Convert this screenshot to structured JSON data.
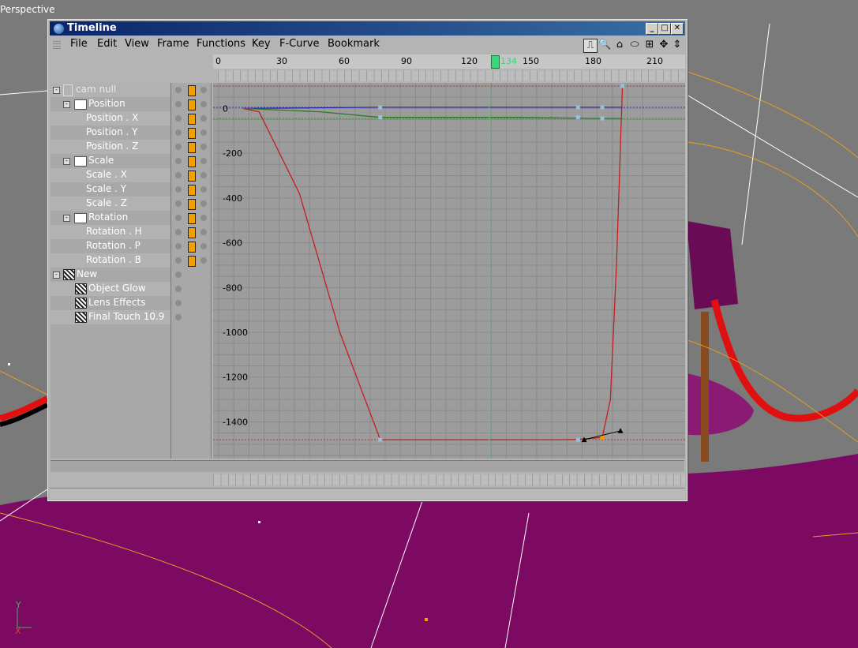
{
  "viewport": {
    "label": "Perspective",
    "axis_y": "Y",
    "axis_x": "X",
    "background_color": "#7a7a7a",
    "floor_color": "#7c0a63"
  },
  "window": {
    "title": "Timeline",
    "controls": {
      "minimize": "_",
      "maximize": "□",
      "close": "✕"
    }
  },
  "menu": [
    "File",
    "Edit",
    "View",
    "Frame",
    "Functions",
    "Key",
    "F-Curve",
    "Bookmark"
  ],
  "toolbar_icons": [
    "curve-mode-icon",
    "zoom-icon",
    "home-icon",
    "ellipse-icon",
    "fit-icon",
    "move-icon",
    "scroll-icon"
  ],
  "toolbar_glyphs": [
    "⎍",
    "🔍",
    "⌂",
    "⬭",
    "⊞",
    "✥",
    "⇕"
  ],
  "ruler": {
    "ticks": [
      "0",
      "30",
      "60",
      "90",
      "120",
      "150",
      "180",
      "210"
    ],
    "current_frame": "134"
  },
  "tree": {
    "rows": [
      {
        "label": "cam null",
        "indent": 0,
        "kind": "object"
      },
      {
        "label": "Position",
        "indent": 1,
        "kind": "folder"
      },
      {
        "label": "Position . X",
        "indent": 2,
        "kind": "track"
      },
      {
        "label": "Position . Y",
        "indent": 2,
        "kind": "track"
      },
      {
        "label": "Position . Z",
        "indent": 2,
        "kind": "track"
      },
      {
        "label": "Scale",
        "indent": 1,
        "kind": "folder"
      },
      {
        "label": "Scale . X",
        "indent": 2,
        "kind": "track"
      },
      {
        "label": "Scale . Y",
        "indent": 2,
        "kind": "track"
      },
      {
        "label": "Scale . Z",
        "indent": 2,
        "kind": "track"
      },
      {
        "label": "Rotation",
        "indent": 1,
        "kind": "folder"
      },
      {
        "label": "Rotation . H",
        "indent": 2,
        "kind": "track"
      },
      {
        "label": "Rotation . P",
        "indent": 2,
        "kind": "track"
      },
      {
        "label": "Rotation . B",
        "indent": 2,
        "kind": "track"
      },
      {
        "label": "New",
        "indent": 0,
        "kind": "effect-group"
      },
      {
        "label": "Object Glow",
        "indent": 1,
        "kind": "effect"
      },
      {
        "label": "Lens Effects",
        "indent": 1,
        "kind": "effect"
      },
      {
        "label": "Final Touch 10.9",
        "indent": 1,
        "kind": "effect"
      }
    ]
  },
  "chart_data": {
    "type": "line",
    "title": "",
    "xlabel": "",
    "ylabel": "",
    "xlim": [
      0,
      215
    ],
    "ylim": [
      -1550,
      100
    ],
    "y_ticks": [
      "0",
      "-200",
      "-400",
      "-600",
      "-800",
      "-1000",
      "-1200",
      "-1400"
    ],
    "current_frame": 134,
    "series": [
      {
        "color": "#c41f1f",
        "x": [
          12,
          20,
          40,
          60,
          80,
          100,
          130,
          170,
          178,
          190,
          194,
          197,
          200
        ],
        "y": [
          0,
          -15,
          -380,
          -1000,
          -1480,
          -1480,
          -1480,
          -1480,
          -1478,
          -1470,
          -1300,
          -700,
          100
        ]
      },
      {
        "color": "#2a2aa8",
        "x": [
          12,
          80,
          120,
          160,
          185,
          200
        ],
        "y": [
          0,
          5,
          5,
          5,
          5,
          5
        ]
      },
      {
        "color": "#2a7a2a",
        "x": [
          12,
          50,
          80,
          150,
          185,
          200
        ],
        "y": [
          0,
          -15,
          -40,
          -40,
          -45,
          -45
        ]
      }
    ],
    "keyframes": [
      {
        "x": 80,
        "y": -1480,
        "color": "#9ac0d8"
      },
      {
        "x": 178,
        "y": -1480,
        "color": "#9ac0d8"
      },
      {
        "x": 190,
        "y": -1470,
        "color": "#f0a000"
      },
      {
        "x": 200,
        "y": 100,
        "color": "#9ac0d8"
      },
      {
        "x": 80,
        "y": 5,
        "color": "#9ac0d8"
      },
      {
        "x": 178,
        "y": 5,
        "color": "#9ac0d8"
      },
      {
        "x": 190,
        "y": 5,
        "color": "#9ac0d8"
      },
      {
        "x": 80,
        "y": -40,
        "color": "#9ac0d8"
      },
      {
        "x": 178,
        "y": -40,
        "color": "#9ac0d8"
      },
      {
        "x": 190,
        "y": -45,
        "color": "#9ac0d8"
      }
    ],
    "tangent_handles": [
      {
        "x": 181,
        "y": -1480
      },
      {
        "x": 199,
        "y": -1440
      }
    ],
    "grid": true
  }
}
